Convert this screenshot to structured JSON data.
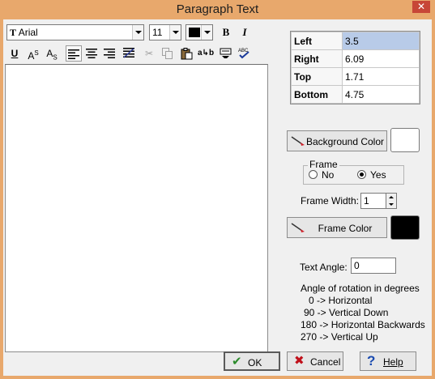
{
  "window": {
    "title": "Paragraph Text"
  },
  "toolbar": {
    "font_name": "Arial",
    "font_size": "11",
    "font_color": "#000000",
    "bold_label": "B",
    "italic_label": "I",
    "underline_label": "U",
    "superscript_label": "A",
    "superscript_mark": "S",
    "subscript_label": "A",
    "subscript_mark": "S"
  },
  "margins": {
    "rows": [
      {
        "label": "Left",
        "value": "3.5"
      },
      {
        "label": "Right",
        "value": "6.09"
      },
      {
        "label": "Top",
        "value": "1.71"
      },
      {
        "label": "Bottom",
        "value": "4.75"
      }
    ]
  },
  "background": {
    "button_label": "Background Color",
    "color": "#ffffff"
  },
  "frame": {
    "group_label": "Frame",
    "no_label": "No",
    "yes_label": "Yes",
    "selected": "Yes",
    "width_label": "Frame Width:",
    "width_value": "1",
    "color_button_label": "Frame Color",
    "color": "#000000"
  },
  "angle": {
    "label": "Text Angle:",
    "value": "0",
    "help_title": "Angle of rotation in degrees",
    "help_lines": [
      "0 -> Horizontal",
      "90 -> Vertical Down",
      "180 -> Horizontal Backwards",
      "270 -> Vertical Up"
    ]
  },
  "buttons": {
    "ok": "OK",
    "cancel": "Cancel",
    "help": "Help"
  },
  "colors": {
    "titlebar": "#e8a86c",
    "close": "#c74637",
    "selection": "#b8cbe8"
  }
}
